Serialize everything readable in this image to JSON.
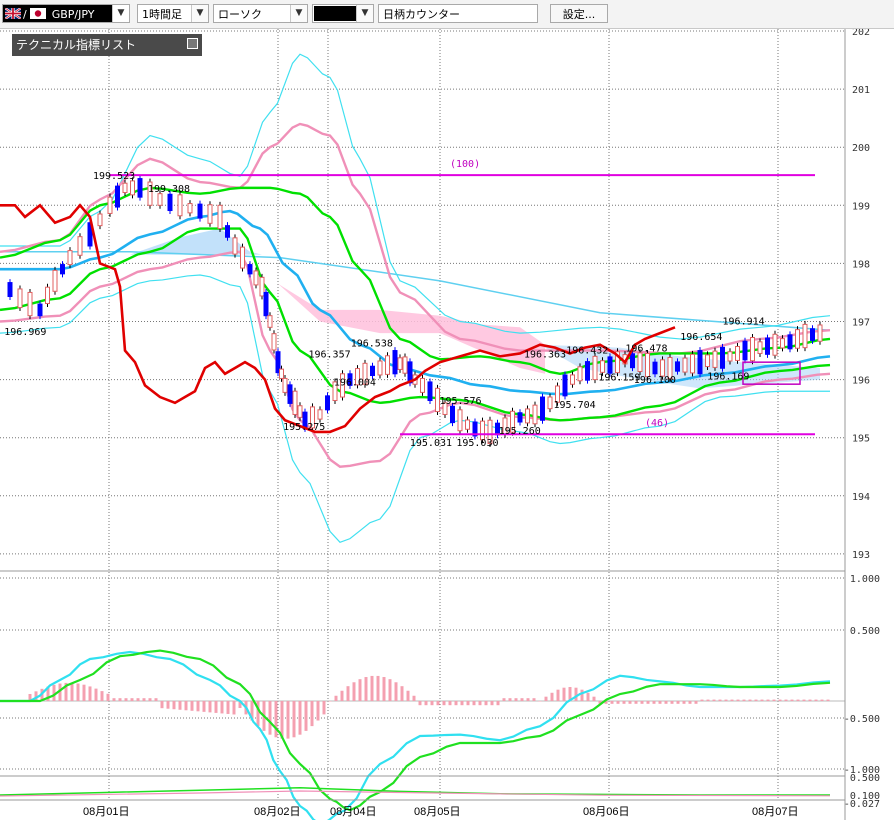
{
  "toolbar": {
    "pair": "GBP/JPY",
    "timeframe": "1時間足",
    "chart_style": "ローソク",
    "color_value": "",
    "counter": "日柄カウンター",
    "settings": "設定..."
  },
  "indicator_list": {
    "label": "テクニカル指標リスト"
  },
  "colors": {
    "up": "#e06060",
    "down": "#0000ff",
    "ma": "#e00000",
    "cloud": "#ffc0dc",
    "cloud2": "#a8d4f8",
    "hline": "#e000e0"
  },
  "chart_data": [
    {
      "type": "candlestick",
      "ylim": [
        193,
        202
      ],
      "y_ticks": [
        "202",
        "201",
        "200",
        "199",
        "198",
        "197",
        "196",
        "195",
        "194",
        "193"
      ],
      "x_ticks": [
        "08月01日",
        "08月02日",
        "08月04日",
        "08月05日",
        "08月06日",
        "08月07日"
      ],
      "grid": true,
      "annotations": [
        {
          "text": "199.523",
          "x": 0.135,
          "y": 199.52
        },
        {
          "text": "199.308",
          "x": 0.2,
          "y": 199.3
        },
        {
          "text": "196.969",
          "x": 0.03,
          "y": 196.84
        },
        {
          "text": "196.357",
          "x": 0.39,
          "y": 196.45
        },
        {
          "text": "196.538",
          "x": 0.44,
          "y": 196.64
        },
        {
          "text": "196.004",
          "x": 0.42,
          "y": 195.97
        },
        {
          "text": "195.275",
          "x": 0.36,
          "y": 195.2
        },
        {
          "text": "195.576",
          "x": 0.545,
          "y": 195.65
        },
        {
          "text": "195.031",
          "x": 0.51,
          "y": 194.93
        },
        {
          "text": "195.030",
          "x": 0.565,
          "y": 194.93
        },
        {
          "text": "195.260",
          "x": 0.615,
          "y": 195.13
        },
        {
          "text": "195.704",
          "x": 0.68,
          "y": 195.58
        },
        {
          "text": "196.363",
          "x": 0.645,
          "y": 196.45
        },
        {
          "text": "196.432",
          "x": 0.695,
          "y": 196.52
        },
        {
          "text": "196.478",
          "x": 0.765,
          "y": 196.55
        },
        {
          "text": "196.159",
          "x": 0.733,
          "y": 196.05
        },
        {
          "text": "196.100",
          "x": 0.775,
          "y": 196.01
        },
        {
          "text": "196.654",
          "x": 0.83,
          "y": 196.75
        },
        {
          "text": "196.914",
          "x": 0.88,
          "y": 197.02
        },
        {
          "text": "196.169",
          "x": 0.862,
          "y": 196.07
        }
      ],
      "hlines": [
        {
          "label": "(100)",
          "y": 199.52
        },
        {
          "label": "(46)",
          "y": 195.06
        }
      ]
    },
    {
      "type": "line",
      "name": "macd",
      "y_ticks": [
        "1.000",
        "0.500",
        "-0.500",
        "-1.000"
      ],
      "ylim": [
        -1.15,
        1.05
      ]
    },
    {
      "type": "line",
      "name": "sub3",
      "y_ticks": [
        "0.500",
        "0.100",
        "-0.027"
      ]
    }
  ]
}
